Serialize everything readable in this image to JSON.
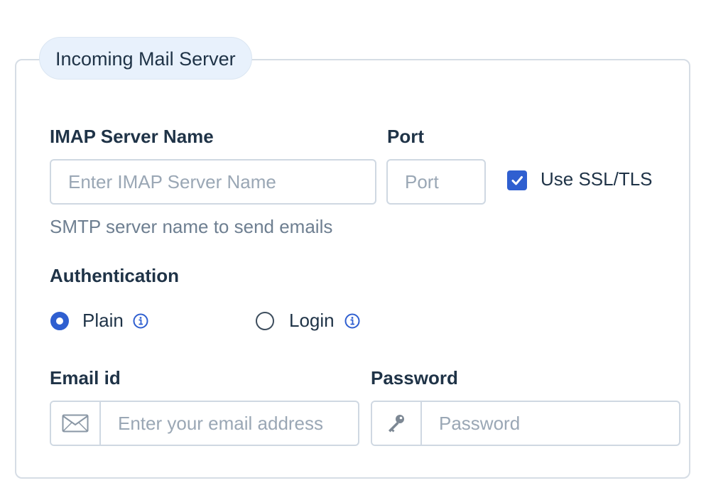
{
  "fieldset": {
    "legend": "Incoming Mail Server"
  },
  "server": {
    "label": "IMAP Server Name",
    "placeholder": "Enter IMAP Server Name",
    "help": "SMTP server name to send emails"
  },
  "port": {
    "label": "Port",
    "placeholder": "Port"
  },
  "ssl": {
    "label": "Use SSL/TLS",
    "checked": true
  },
  "auth": {
    "label": "Authentication",
    "options": [
      {
        "label": "Plain",
        "selected": true,
        "icon": "info-icon"
      },
      {
        "label": "Login",
        "selected": false,
        "icon": "info-icon"
      }
    ]
  },
  "email": {
    "label": "Email id",
    "placeholder": "Enter your email address",
    "icon": "envelope-icon"
  },
  "password": {
    "label": "Password",
    "placeholder": "Password",
    "icon": "key-icon"
  },
  "colors": {
    "accent": "#2f5fd0",
    "border": "#cfd8e2",
    "legend_bg": "#e8f1fc"
  }
}
